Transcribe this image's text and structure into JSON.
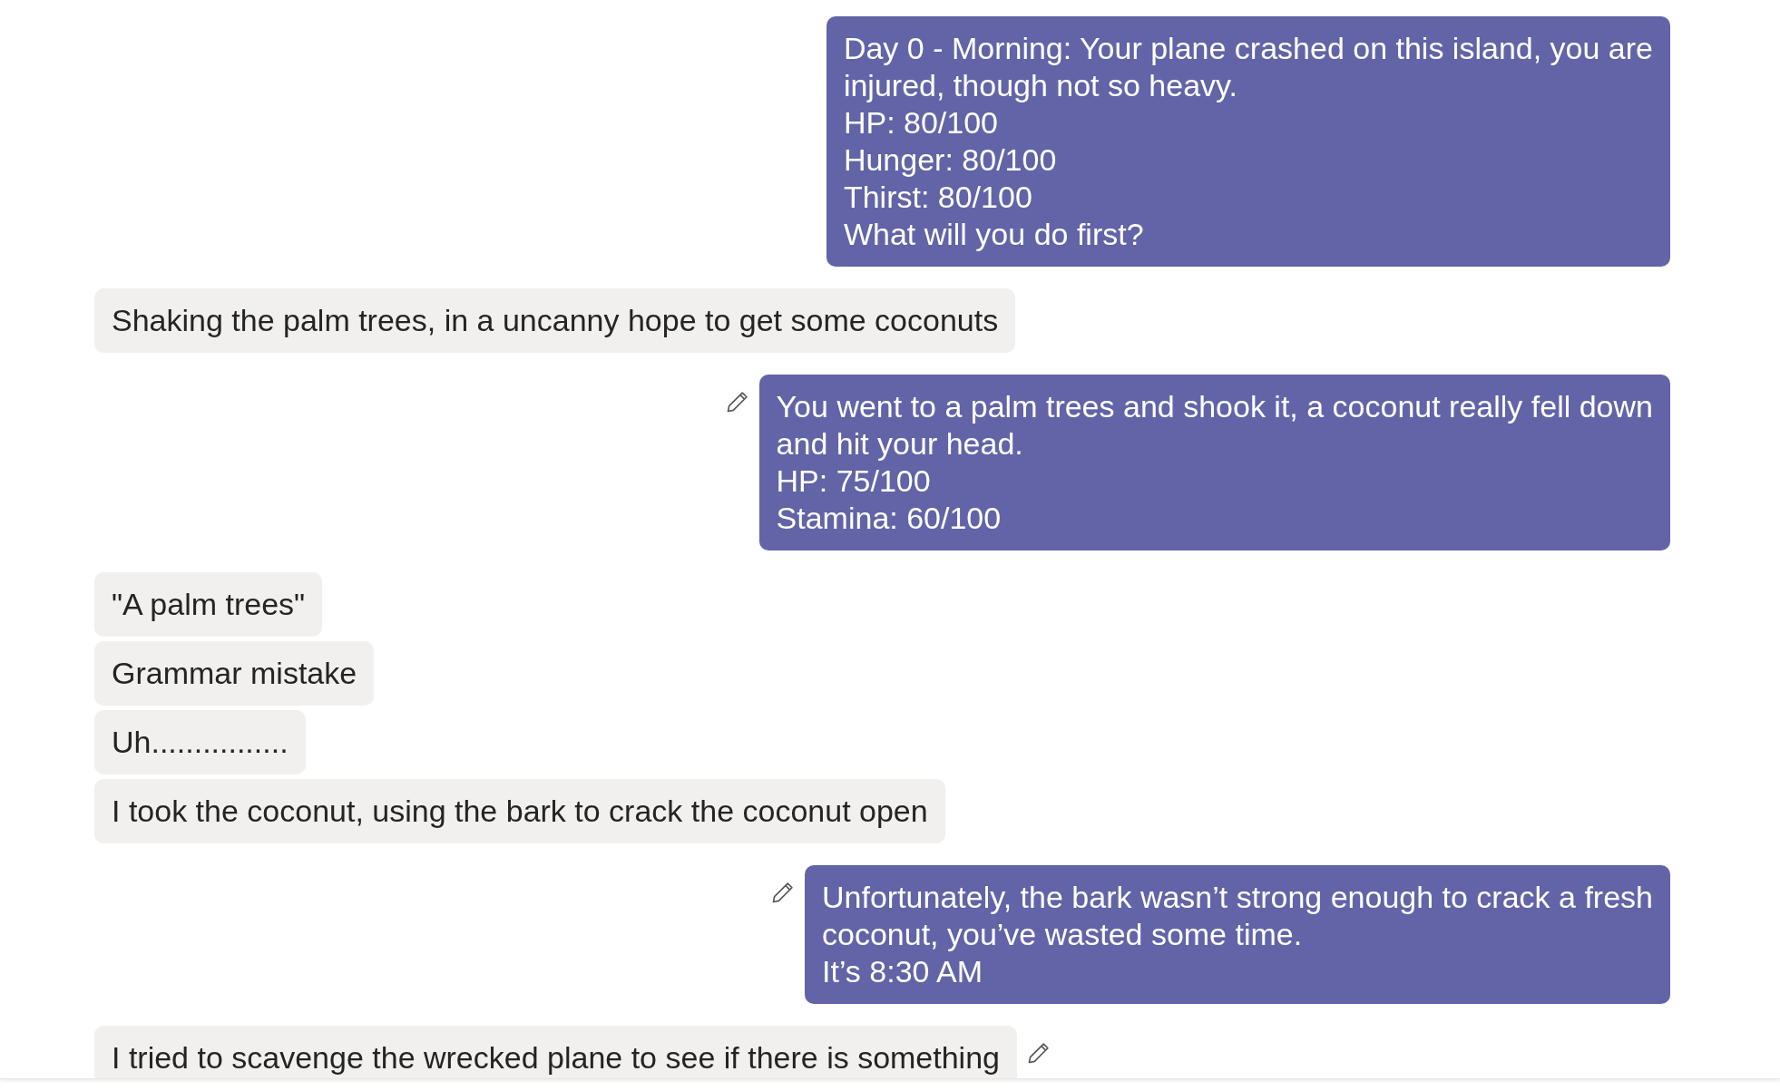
{
  "messages": [
    {
      "kind": "outgoing",
      "edit_icon": false,
      "lines": [
        "Day 0 - Morning: Your plane crashed on this island, you are",
        "injured, though not so heavy.",
        "HP: 80/100",
        "Hunger: 80/100",
        "Thirst: 80/100",
        "What will you do first?"
      ]
    },
    {
      "kind": "incoming",
      "edit_icon": false,
      "lines": [
        "Shaking the palm trees, in a uncanny hope to get some coconuts"
      ]
    },
    {
      "kind": "outgoing",
      "edit_icon": true,
      "lines": [
        "You went to a palm trees and shook it, a coconut really fell down",
        "and hit your head.",
        "HP: 75/100",
        "Stamina: 60/100"
      ]
    },
    {
      "kind": "incoming",
      "edit_icon": false,
      "lines": [
        "\"A palm trees\""
      ]
    },
    {
      "kind": "incoming",
      "edit_icon": false,
      "lines": [
        "Grammar mistake"
      ]
    },
    {
      "kind": "incoming",
      "edit_icon": false,
      "lines": [
        "Uh................"
      ]
    },
    {
      "kind": "incoming",
      "edit_icon": false,
      "lines": [
        "I took the coconut, using the bark to crack the coconut open"
      ]
    },
    {
      "kind": "outgoing",
      "edit_icon": true,
      "lines": [
        "Unfortunately, the bark wasn’t strong enough to crack a fresh",
        "coconut, you’ve wasted some time.",
        "It’s 8:30 AM"
      ]
    },
    {
      "kind": "incoming",
      "edit_icon": true,
      "lines": [
        "I tried to scavenge the wrecked plane to see if there is something"
      ]
    }
  ]
}
